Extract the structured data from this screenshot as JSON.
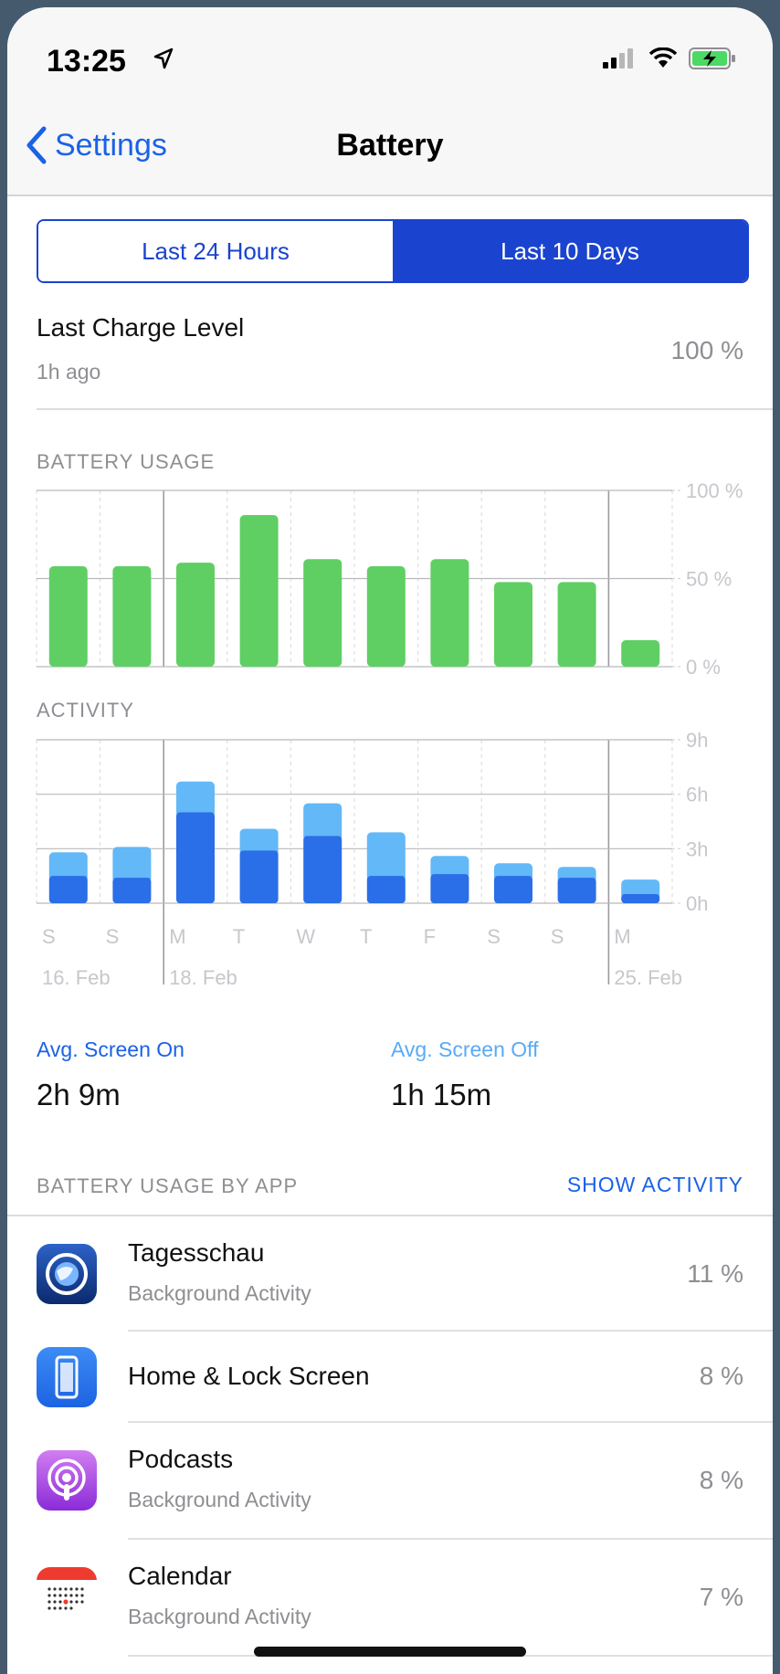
{
  "status": {
    "time": "13:25"
  },
  "nav": {
    "back_label": "Settings",
    "title": "Battery"
  },
  "segments": [
    "Last 24 Hours",
    "Last 10 Days"
  ],
  "selected_segment": 1,
  "last_charge": {
    "title": "Last Charge Level",
    "ago": "1h ago",
    "value": "100 %"
  },
  "battery_usage_header": "BATTERY USAGE",
  "activity_header": "ACTIVITY",
  "chart_data": [
    {
      "type": "bar",
      "title": "BATTERY USAGE",
      "categories": [
        "S",
        "S",
        "M",
        "T",
        "W",
        "T",
        "F",
        "S",
        "S",
        "M"
      ],
      "date_labels": [
        "16. Feb",
        "18. Feb",
        "25. Feb"
      ],
      "values": [
        57,
        57,
        59,
        86,
        61,
        57,
        61,
        48,
        48,
        15
      ],
      "y_ticks": [
        "100 %",
        "50 %",
        "0 %"
      ],
      "ylim": [
        0,
        100
      ],
      "color": "#5fcf63"
    },
    {
      "type": "bar",
      "title": "ACTIVITY",
      "categories": [
        "S",
        "S",
        "M",
        "T",
        "W",
        "T",
        "F",
        "S",
        "S",
        "M"
      ],
      "series": [
        {
          "values": [
            1.5,
            1.4,
            5.0,
            2.9,
            3.7,
            1.5,
            1.6,
            1.5,
            1.4,
            0.5
          ],
          "color": "#2a6ee8"
        },
        {
          "values": [
            1.3,
            1.7,
            1.7,
            1.2,
            1.8,
            2.4,
            1.0,
            0.7,
            0.6,
            0.8
          ],
          "color": "#63b8f7"
        }
      ],
      "y_ticks": [
        "9h",
        "6h",
        "3h",
        "0h"
      ],
      "ylim": [
        0,
        9
      ]
    }
  ],
  "averages": {
    "on_label": "Avg. Screen On",
    "on_value": "2h 9m",
    "off_label": "Avg. Screen Off",
    "off_value": "1h 15m"
  },
  "by_app_header": "BATTERY USAGE BY APP",
  "show_activity": "SHOW ACTIVITY",
  "apps": [
    {
      "name": "Tagesschau",
      "sub": "Background Activity",
      "pct": "11 %"
    },
    {
      "name": "Home & Lock Screen",
      "sub": "",
      "pct": "8 %"
    },
    {
      "name": "Podcasts",
      "sub": "Background Activity",
      "pct": "8 %"
    },
    {
      "name": "Calendar",
      "sub": "Background Activity",
      "pct": "7 %"
    }
  ],
  "colors": {
    "accent": "#1a44cf",
    "link": "#1a62e6",
    "battery_bar": "#5fcf63",
    "screen_on": "#2a6ee8",
    "screen_off": "#63b8f7",
    "off_label": "#5aaaf5"
  }
}
